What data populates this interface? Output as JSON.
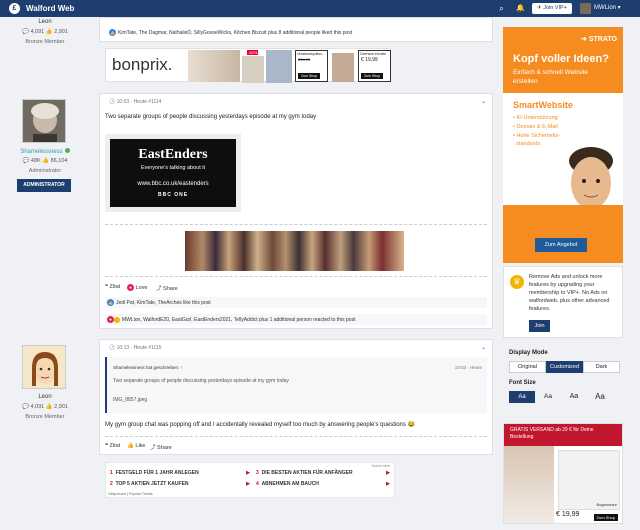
{
  "topbar": {
    "logo": "£",
    "brand": "Walford Web",
    "join": "Join VIP+",
    "user": "MWLion",
    "search_icon": "search-icon",
    "bell_icon": "bell-icon"
  },
  "users": [
    {
      "name": "Leon",
      "stats": "💬 4,091  👍 2,901",
      "rank": "Bronze Member"
    },
    {
      "name": "Shamelessness",
      "stats": "💬 48K  👍 86,104",
      "rank": "Administrator",
      "badge": "ADMINISTRATOR"
    },
    {
      "name": "Leon",
      "stats": "💬 4,091  👍 2,901",
      "rank": "Bronze Member"
    }
  ],
  "post0": {
    "reactions": "KimTate, The Dagmar, NathalieD, SillyGooseWicks, Kitchen Biscuit plus 8 additional people liked this post"
  },
  "ad1": {
    "brand": "bonprix.",
    "tag": "-52%",
    "p1": "€34,99",
    "p2": "€ 19,99",
    "b1": "Zum Shop",
    "b2": "Zum Shop",
    "b3": "Zum Shop",
    "l1": "Umstandspullov...",
    "l2": "Oversize-Hoodie"
  },
  "post1": {
    "meta": "🕐 10:03 · Heute #1114",
    "text": "Two separate groups of people discussing yesterdays episode at my gym today",
    "ee_title": "EastEnders",
    "ee_sub": "Everyone's talking about it",
    "ee_url": "www.bbc.co.uk/eastenders",
    "ee_bbc": "BBC ONE",
    "actions": {
      "quote": "Zitat",
      "love": "Love",
      "share": "Share"
    },
    "likes": "Jedi Pat, KimTate, TheArches like this post",
    "reacted": "MWLion, WalfordE20, EastGurl, EastEnders2021, TellyAddict plus 1 additional person reacted to this post"
  },
  "post2": {
    "meta": "🕐 10:13 · Heute #1115",
    "quote_author": "Shamelessness hat geschrieben: ↑",
    "quote_time": "10:03 · Heute",
    "quote_text": "Two separate groups of people discussing yesterdays episode at my gym today",
    "quote_img": "IMG_8857.jpeg",
    "text": "My gym group chat was popping off and I accidentally revealed myself too much by answering people's questions 😂",
    "actions": {
      "quote": "Zitat",
      "like": "Like",
      "share": "Share"
    }
  },
  "ad3": {
    "label": "Suche nach",
    "items": [
      {
        "n": "1",
        "t": "FESTGELD FÜR 1 JAHR ANLEGEN"
      },
      {
        "n": "2",
        "t": "TOP 5 AKTIEN JETZT KAUFEN"
      },
      {
        "n": "3",
        "t": "DIE BESTEN AKTIEN FÜR ANFÄNGER"
      },
      {
        "n": "4",
        "t": "ABNEHMEN AM BAUCH"
      }
    ],
    "footer": "Gesponsert | Popular Trends"
  },
  "strato": {
    "logo": "➔ STRATO",
    "h1": "Kopf voller Ideen?",
    "sub": "Einfach & schnell Website erstellen",
    "sw": "SmartWebsite",
    "f1": "• KI-Unterstützung",
    "f2": "• Domain & E-Mail",
    "f3": "• Hohe Sicherheits-",
    "f4": "  standards",
    "btn": "Zum Angebot"
  },
  "vip": {
    "text": "Remove Ads and unlock more features by upgrading your membership to VIP+. No Ads on walfordweb, plus other advanced features.",
    "btn": "Join"
  },
  "display": {
    "label": "Display Mode",
    "options": [
      "Original",
      "Customized",
      "Dark"
    ],
    "font_label": "Font Size",
    "sizes": [
      "Aa",
      "Aa",
      "Aa",
      "Aa"
    ]
  },
  "ad4": {
    "banner": "GRATIS VERSAND ab 29 € für Deine Bestellung",
    "price": "€ 19,99",
    "brand": "Bogenstore",
    "btn": "Zum Shop"
  },
  "colors": {
    "nav": "#1d3e6e",
    "strato": "#f68b1f",
    "accent": "#1d3e6e",
    "red": "#c0172e"
  }
}
